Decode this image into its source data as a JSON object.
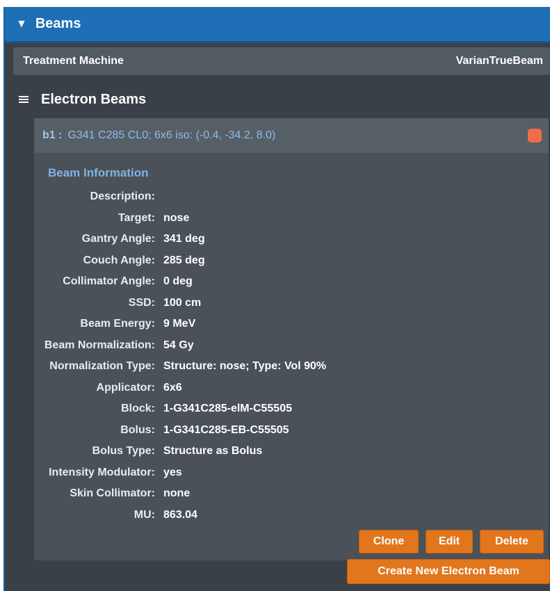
{
  "header": {
    "title": "Beams",
    "toggle_glyph": "▼"
  },
  "machine": {
    "label": "Treatment Machine",
    "value": "VarianTrueBeam"
  },
  "section": {
    "title": "Electron Beams",
    "menu_icon": "hamburger-menu-icon"
  },
  "beam": {
    "id": "b1 :",
    "description": "G341 C285 CL0; 6x6 iso: (-0.4, -34.2, 8.0)",
    "status_color": "#ef6c4a",
    "info_title": "Beam Information",
    "fields": [
      {
        "label": "Description:",
        "value": ""
      },
      {
        "label": "Target:",
        "value": "nose"
      },
      {
        "label": "Gantry Angle:",
        "value": "341 deg"
      },
      {
        "label": "Couch Angle:",
        "value": "285 deg"
      },
      {
        "label": "Collimator Angle:",
        "value": "0 deg"
      },
      {
        "label": "SSD:",
        "value": "100 cm"
      },
      {
        "label": "Beam Energy:",
        "value": "9 MeV"
      },
      {
        "label": "Beam Normalization:",
        "value": "54 Gy"
      },
      {
        "label": "Normalization Type:",
        "value": "Structure: nose;  Type: Vol 90%"
      },
      {
        "label": "Applicator:",
        "value": "6x6"
      },
      {
        "label": "Block:",
        "value": "1-G341C285-elM-C55505"
      },
      {
        "label": "Bolus:",
        "value": "1-G341C285-EB-C55505"
      },
      {
        "label": "Bolus Type:",
        "value": "Structure as Bolus"
      },
      {
        "label": "Intensity Modulator:",
        "value": "yes"
      },
      {
        "label": "Skin Collimator:",
        "value": "none"
      },
      {
        "label": "MU:",
        "value": "863.04"
      }
    ],
    "buttons": {
      "clone": "Clone",
      "edit": "Edit",
      "delete": "Delete"
    }
  },
  "create_button": "Create New Electron Beam",
  "colors": {
    "accent": "#e2761c",
    "header": "#1e6fb6",
    "panel": "#3a4047"
  }
}
